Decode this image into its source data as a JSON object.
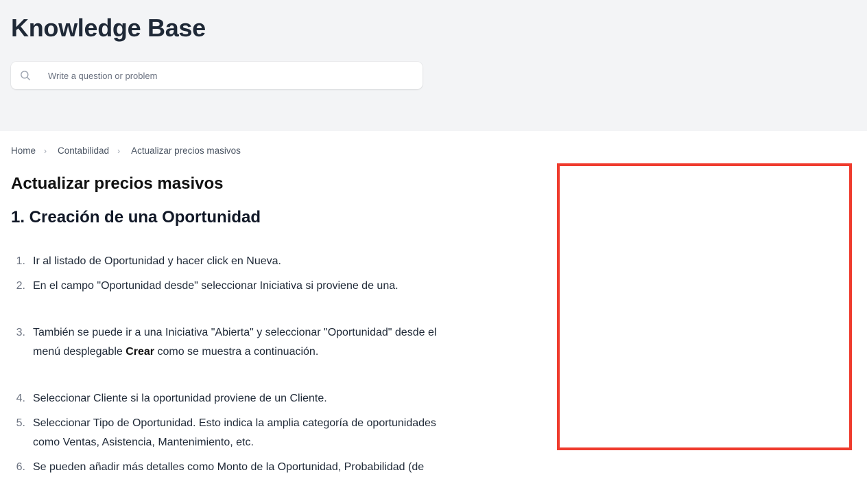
{
  "hero": {
    "title": "Knowledge Base",
    "search_placeholder": "Write a question or problem",
    "search_icon": "search-icon"
  },
  "breadcrumb": {
    "items": [
      "Home",
      "Contabilidad",
      "Actualizar precios masivos"
    ],
    "separator": "›"
  },
  "article": {
    "title": "Actualizar precios masivos",
    "section_title": "1. Creación de una Oportunidad",
    "steps": [
      {
        "num": "1.",
        "text": "Ir al listado de Oportunidad y hacer click en Nueva."
      },
      {
        "num": "2.",
        "text": "En el campo \"Oportunidad desde\" seleccionar Iniciativa si proviene de una."
      },
      {
        "num": "3.",
        "text_before": "También se puede ir a una Iniciativa \"Abierta\" y seleccionar \"Oportunidad\" desde el menú desplegable ",
        "bold": "Crear",
        "text_after": " como se muestra a continuación."
      },
      {
        "num": "4.",
        "text": "Seleccionar Cliente si la oportunidad proviene de un Cliente."
      },
      {
        "num": "5.",
        "text": "Seleccionar Tipo de Oportunidad. Esto indica la amplia categoría de oportunidades como Ventas, Asistencia, Mantenimiento, etc."
      },
      {
        "num": "6.",
        "text": "Se pueden añadir más detalles como Monto de la Oportunidad, Probabilidad (de"
      }
    ]
  },
  "colors": {
    "hero_background": "#f3f4f6",
    "highlight_border": "#ef3b2d"
  }
}
